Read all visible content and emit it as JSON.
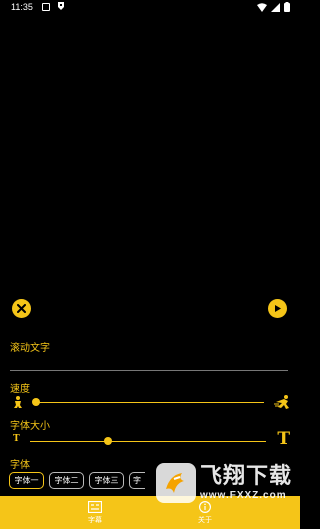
{
  "status_bar": {
    "time": "11:35",
    "icons": [
      "notification-icon",
      "app-notification-icon",
      "wifi-icon",
      "signal-icon",
      "battery-icon"
    ]
  },
  "controls": {
    "close_icon": "close-icon",
    "play_icon": "play-icon"
  },
  "scroll_text": {
    "label": "滚动文字",
    "value": "",
    "placeholder": ""
  },
  "speed": {
    "label": "速度",
    "value_fraction": 0.0,
    "left_icon": "slow-runner-icon",
    "right_icon": "fast-runner-icon"
  },
  "font_size": {
    "label": "字体大小",
    "value_fraction": 0.33,
    "small_glyph": "T",
    "large_glyph": "T"
  },
  "font": {
    "label": "字体",
    "options": [
      "字体一",
      "字体二",
      "字体三",
      "字"
    ],
    "selected_index": 0
  },
  "bottom_nav": {
    "items": [
      {
        "label": "字幕",
        "icon": "subtitle-icon"
      },
      {
        "label": "关于",
        "icon": "about-icon"
      }
    ]
  },
  "watermark": {
    "title": "飞翔下载",
    "url": "www.FXXZ.com"
  },
  "colors": {
    "accent": "#f5c518",
    "background": "#000000"
  }
}
